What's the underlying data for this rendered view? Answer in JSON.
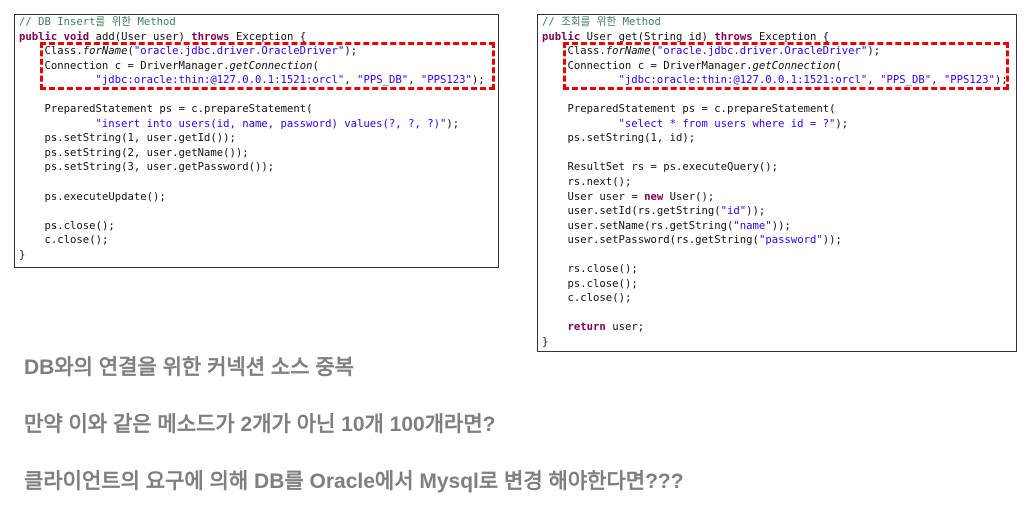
{
  "code_panels": {
    "insert": {
      "lines": [
        "// DB Insert를 위한 Method",
        "public void add(User user) throws Exception {",
        "    Class.forName(\"oracle.jdbc.driver.OracleDriver\");",
        "    Connection c = DriverManager.getConnection(",
        "            \"jdbc:oracle:thin:@127.0.0.1:1521:orcl\", \"PPS_DB\", \"PPS123\");",
        "",
        "    PreparedStatement ps = c.prepareStatement(",
        "            \"insert into users(id, name, password) values(?, ?, ?)\");",
        "    ps.setString(1, user.getId());",
        "    ps.setString(2, user.getName());",
        "    ps.setString(3, user.getPassword());",
        "",
        "    ps.executeUpdate();",
        "",
        "    ps.close();",
        "    c.close();",
        "}"
      ]
    },
    "get": {
      "lines": [
        "// 조회를 위한 Method",
        "public User get(String id) throws Exception {",
        "    Class.forName(\"oracle.jdbc.driver.OracleDriver\");",
        "    Connection c = DriverManager.getConnection(",
        "            \"jdbc:oracle:thin:@127.0.0.1:1521:orcl\", \"PPS_DB\", \"PPS123\");",
        "",
        "    PreparedStatement ps = c.prepareStatement(",
        "            \"select * from users where id = ?\");",
        "    ps.setString(1, id);",
        "",
        "    ResultSet rs = ps.executeQuery();",
        "    rs.next();",
        "    User user = new User();",
        "    user.setId(rs.getString(\"id\"));",
        "    user.setName(rs.getString(\"name\"));",
        "    user.setPassword(rs.getString(\"password\"));",
        "",
        "    rs.close();",
        "    ps.close();",
        "    c.close();",
        "",
        "    return user;",
        "}"
      ]
    }
  },
  "notes": [
    "DB와의 연결을 위한 커넥션 소스 중복",
    "만약 이와 같은 메소드가 2개가 아닌 10개 100개라면?",
    "클라이언트의 요구에 의해 DB를 Oracle에서 Mysql로 변경 해야한다면???"
  ],
  "colors": {
    "keyword": "#7f0055",
    "string": "#2a00ff",
    "comment": "#3f7f5f",
    "highlight_box": "#e60000",
    "note_text": "#7f7f7f",
    "panel_border": "#333333"
  }
}
